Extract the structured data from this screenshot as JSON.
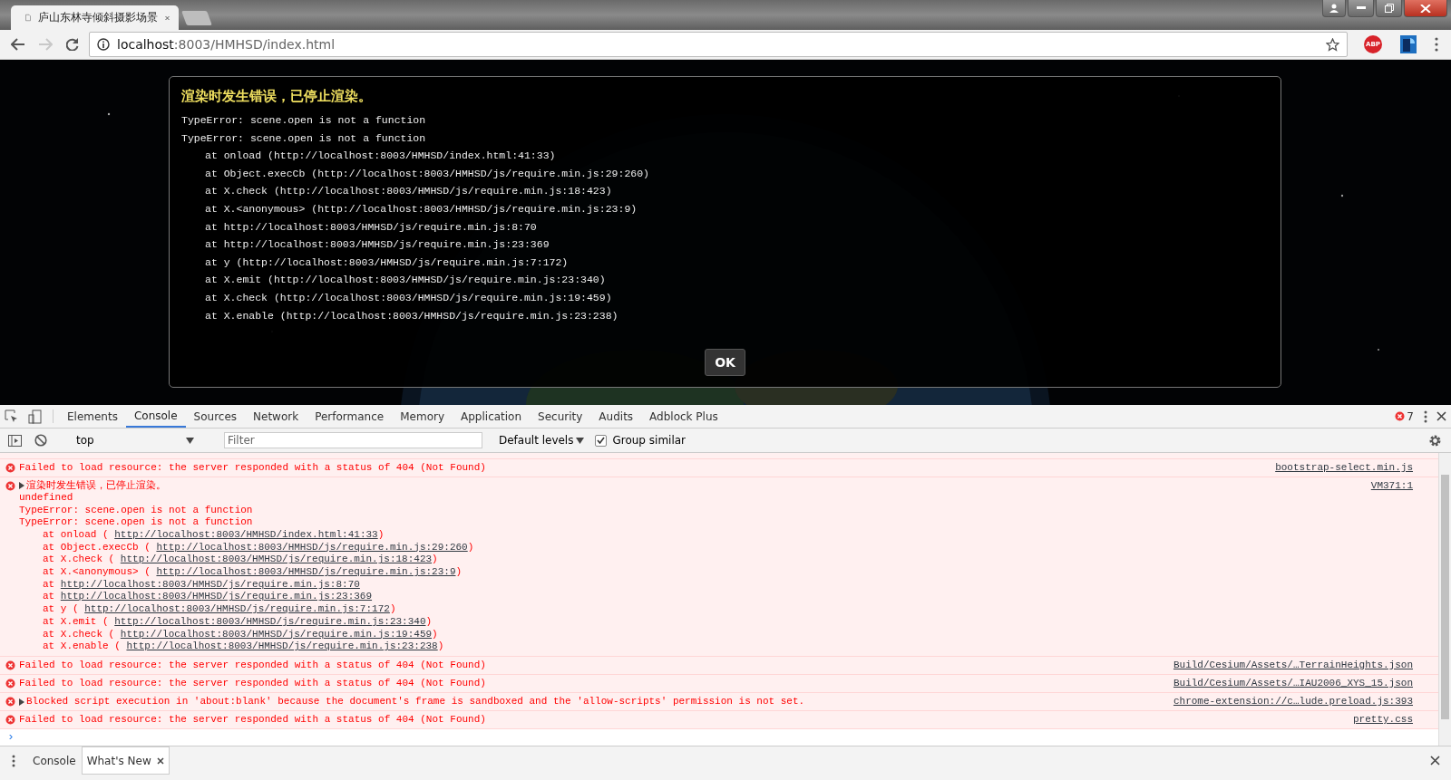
{
  "browser": {
    "tab": {
      "title": "庐山东林寺倾斜摄影场景"
    },
    "address": {
      "host": "localhost",
      "path": ":8003/HMHSD/index.html"
    },
    "forward_disabled": true,
    "extension_badge": "ABP"
  },
  "dialog": {
    "title": "渲染时发生错误，已停止渲染。",
    "lines": [
      {
        "kind": "message",
        "text": "TypeError: scene.open is not a function"
      },
      {
        "kind": "message",
        "text": "TypeError: scene.open is not a function"
      },
      {
        "kind": "stack",
        "text": "at onload (http://localhost:8003/HMHSD/index.html:41:33)"
      },
      {
        "kind": "stack",
        "text": "at Object.execCb (http://localhost:8003/HMHSD/js/require.min.js:29:260)"
      },
      {
        "kind": "stack",
        "text": "at X.check (http://localhost:8003/HMHSD/js/require.min.js:18:423)"
      },
      {
        "kind": "stack",
        "text": "at X.<anonymous> (http://localhost:8003/HMHSD/js/require.min.js:23:9)"
      },
      {
        "kind": "stack",
        "text": "at http://localhost:8003/HMHSD/js/require.min.js:8:70"
      },
      {
        "kind": "stack",
        "text": "at http://localhost:8003/HMHSD/js/require.min.js:23:369"
      },
      {
        "kind": "stack",
        "text": "at y (http://localhost:8003/HMHSD/js/require.min.js:7:172)"
      },
      {
        "kind": "stack",
        "text": "at X.emit (http://localhost:8003/HMHSD/js/require.min.js:23:340)"
      },
      {
        "kind": "stack",
        "text": "at X.check (http://localhost:8003/HMHSD/js/require.min.js:19:459)"
      },
      {
        "kind": "stack",
        "text": "at X.enable (http://localhost:8003/HMHSD/js/require.min.js:23:238)"
      }
    ],
    "button": "OK"
  },
  "devtools": {
    "tabs": [
      {
        "label": "Elements",
        "selected": false
      },
      {
        "label": "Console",
        "selected": true
      },
      {
        "label": "Sources",
        "selected": false
      },
      {
        "label": "Network",
        "selected": false
      },
      {
        "label": "Performance",
        "selected": false
      },
      {
        "label": "Memory",
        "selected": false
      },
      {
        "label": "Application",
        "selected": false
      },
      {
        "label": "Security",
        "selected": false
      },
      {
        "label": "Audits",
        "selected": false
      },
      {
        "label": "Adblock Plus",
        "selected": false
      }
    ],
    "error_count": "7",
    "context": "top",
    "filter": {
      "placeholder": "Filter"
    },
    "levels": "Default levels",
    "group_similar": {
      "label": "Group similar",
      "checked": true
    },
    "messages": [
      {
        "expandable": false,
        "text": "Failed to load resource: the server responded with a status of 404 (Not Found)",
        "source": "bootstrap-select.min.js"
      },
      {
        "expandable": true,
        "text": "渲染时发生错误，已停止渲染。",
        "source": "VM371:1",
        "details": [
          {
            "kind": "text",
            "text": "undefined"
          },
          {
            "kind": "text",
            "text": "TypeError: scene.open is not a function"
          },
          {
            "kind": "text",
            "text": "TypeError: scene.open is not a function"
          },
          {
            "kind": "frame",
            "prefix": "at onload (",
            "link": "http://localhost:8003/HMHSD/index.html:41:33",
            "suffix": ")"
          },
          {
            "kind": "frame",
            "prefix": "at Object.execCb (",
            "link": "http://localhost:8003/HMHSD/js/require.min.js:29:260",
            "suffix": ")"
          },
          {
            "kind": "frame",
            "prefix": "at X.check (",
            "link": "http://localhost:8003/HMHSD/js/require.min.js:18:423",
            "suffix": ")"
          },
          {
            "kind": "frame",
            "prefix": "at X.<anonymous> (",
            "link": "http://localhost:8003/HMHSD/js/require.min.js:23:9",
            "suffix": ")"
          },
          {
            "kind": "frame",
            "prefix": "at",
            "link": "http://localhost:8003/HMHSD/js/require.min.js:8:70"
          },
          {
            "kind": "frame",
            "prefix": "at",
            "link": "http://localhost:8003/HMHSD/js/require.min.js:23:369"
          },
          {
            "kind": "frame",
            "prefix": "at y (",
            "link": "http://localhost:8003/HMHSD/js/require.min.js:7:172",
            "suffix": ")"
          },
          {
            "kind": "frame",
            "prefix": "at X.emit (",
            "link": "http://localhost:8003/HMHSD/js/require.min.js:23:340",
            "suffix": ")"
          },
          {
            "kind": "frame",
            "prefix": "at X.check (",
            "link": "http://localhost:8003/HMHSD/js/require.min.js:19:459",
            "suffix": ")"
          },
          {
            "kind": "frame",
            "prefix": "at X.enable (",
            "link": "http://localhost:8003/HMHSD/js/require.min.js:23:238",
            "suffix": ")"
          }
        ]
      },
      {
        "expandable": false,
        "text": "Failed to load resource: the server responded with a status of 404 (Not Found)",
        "source": "Build/Cesium/Assets/…TerrainHeights.json"
      },
      {
        "expandable": false,
        "text": "Failed to load resource: the server responded with a status of 404 (Not Found)",
        "source": "Build/Cesium/Assets/…IAU2006_XYS_15.json"
      },
      {
        "expandable": true,
        "text": "Blocked script execution in 'about:blank' because the document's frame is sandboxed and the 'allow-scripts' permission is not set.",
        "source": "chrome-extension://c…lude.preload.js:393"
      },
      {
        "expandable": false,
        "text": "Failed to load resource: the server responded with a status of 404 (Not Found)",
        "source": "pretty.css"
      }
    ],
    "prompt": "›",
    "drawer_tabs": [
      {
        "label": "Console",
        "selected": false,
        "closable": false
      },
      {
        "label": "What's New",
        "selected": true,
        "closable": true
      }
    ]
  }
}
